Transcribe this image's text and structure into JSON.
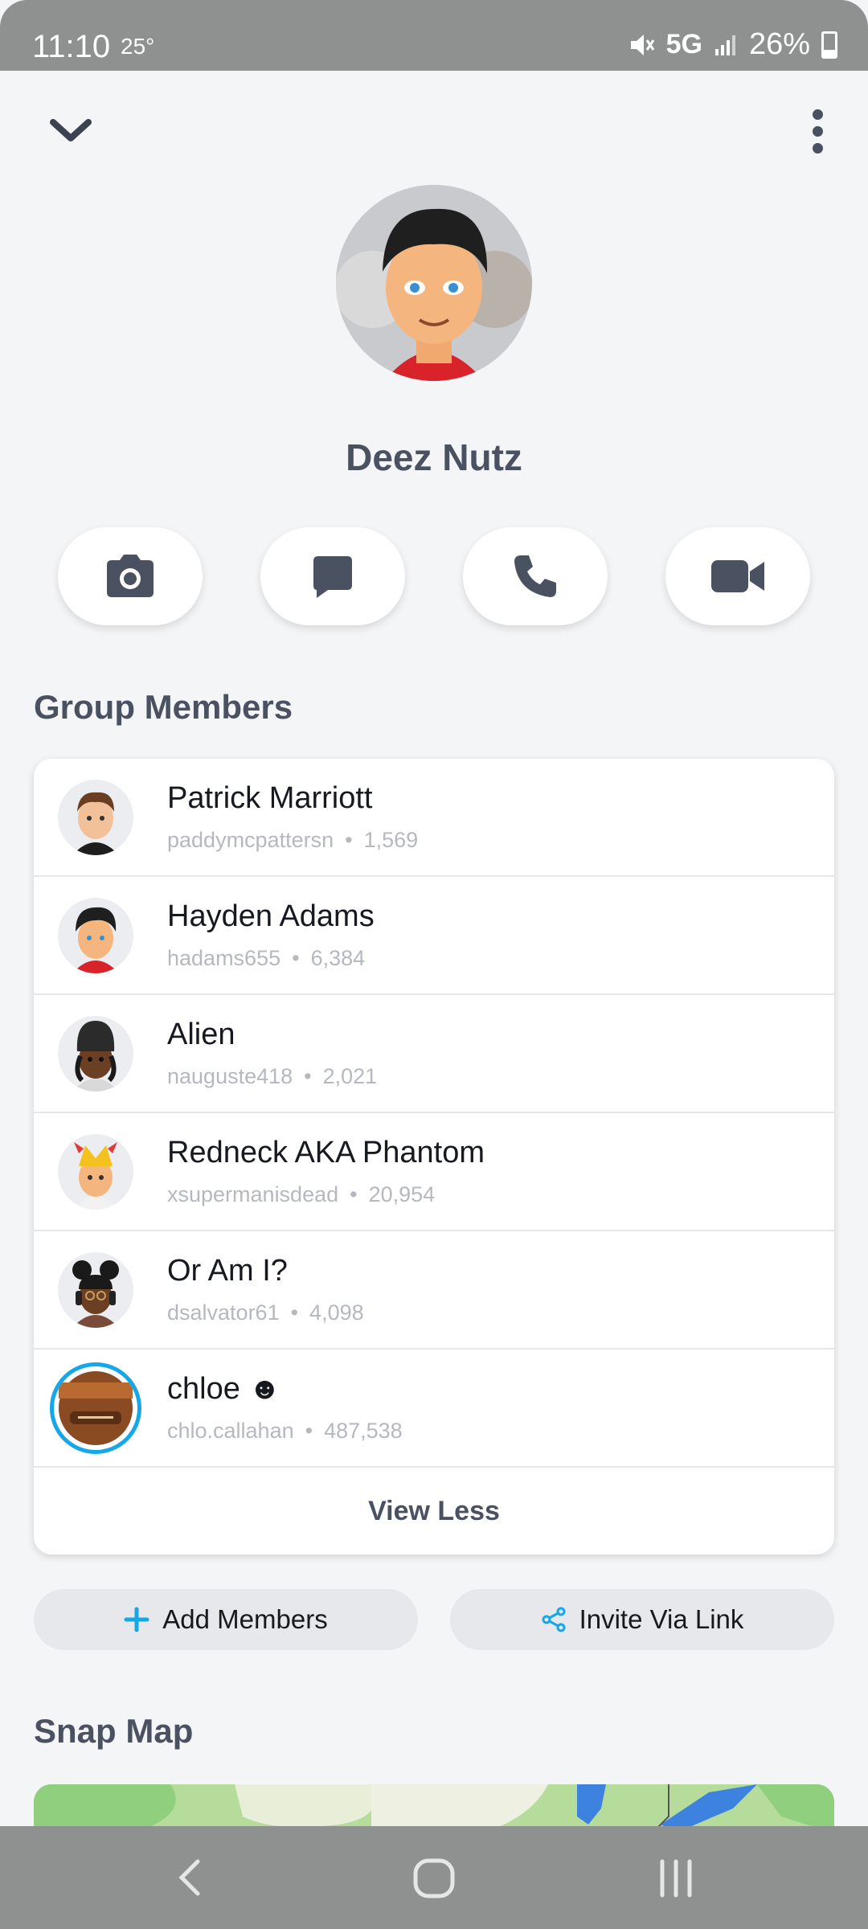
{
  "status_bar": {
    "time": "11:10",
    "temp": "25°",
    "network": "5G",
    "battery": "26%"
  },
  "group": {
    "name": "Deez Nutz"
  },
  "sections": {
    "members_title": "Group Members",
    "map_title": "Snap Map"
  },
  "members": [
    {
      "name": "Patrick Marriott",
      "username": "paddymcpattersn",
      "score": "1,569"
    },
    {
      "name": "Hayden Adams",
      "username": "hadams655",
      "score": "6,384"
    },
    {
      "name": "Alien",
      "username": "nauguste418",
      "score": "2,021"
    },
    {
      "name": "Redneck AKA Phantom",
      "username": "xsupermanisdead",
      "score": "20,954"
    },
    {
      "name": "Or Am I?",
      "username": "dsalvator61",
      "score": "4,098"
    },
    {
      "name": "chloe ☻",
      "username": "chlo.callahan",
      "score": "487,538"
    }
  ],
  "buttons": {
    "view_less": "View Less",
    "add_members": "Add Members",
    "invite_link": "Invite Via Link"
  },
  "colors": {
    "accent": "#16a7e8",
    "text_dark": "#4a5160",
    "background": "#f4f5f7"
  },
  "icons": [
    "chevron-down-icon",
    "more-icon",
    "camera-icon",
    "chat-icon",
    "phone-icon",
    "video-icon",
    "plus-icon",
    "share-icon"
  ]
}
